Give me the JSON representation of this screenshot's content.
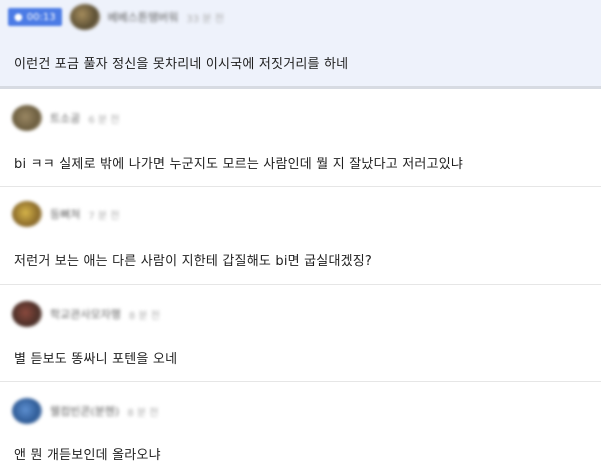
{
  "comments": [
    {
      "badge": "00:13",
      "nickname": "베베스튼땡버워",
      "time": "33 분 전",
      "text": "이런건 포금 풀자 정신을 못차리네 이시국에 저짓거리를 하네"
    },
    {
      "nickname": "트소공",
      "time": "6 분 전",
      "text": "bi ㅋㅋ 실제로 밖에 나가면 누군지도 모르는 사람인데 뭘 지 잘났다고 저러고있냐"
    },
    {
      "nickname": "등뼈쳐",
      "time": "7 분 전",
      "text": "저런거 보는 애는 다른 사람이 지한테 갑질해도 bi면 굽실대겠징?"
    },
    {
      "nickname": "학교관사모자행",
      "time": "8 분 전",
      "text": "별 듣보도 똥싸니 포텐을 오네"
    },
    {
      "nickname": "웰컴빈콘(분헨)",
      "time": "8 분 전",
      "text": "앤 뭔 개듣보인데 올라오냐"
    }
  ]
}
